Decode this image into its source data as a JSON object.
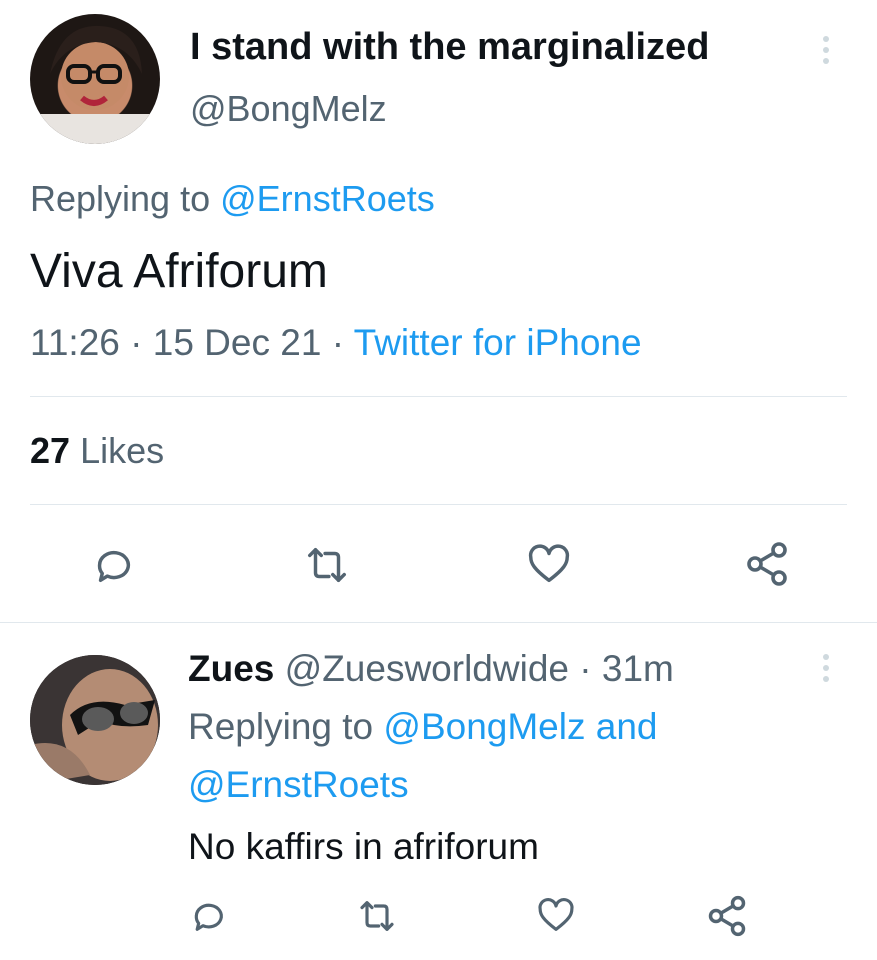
{
  "tweet": {
    "display_name": "I stand with the marginalized",
    "handle": "@BongMelz",
    "replying_prefix": "Replying to",
    "replying_to": "@ErnstRoets",
    "text": "Viva Afriforum",
    "time": "11:26",
    "sep1": "·",
    "date": "15 Dec 21",
    "sep2": "·",
    "source": "Twitter for iPhone",
    "likes_count": "27",
    "likes_label": "Likes"
  },
  "reply": {
    "display_name": "Zues",
    "handle": "@Zuesworldwide",
    "sep": "·",
    "time_ago": "31m",
    "replying_prefix": "Replying to",
    "replying_to_1": "@BongMelz",
    "and": "and",
    "replying_to_2": "@ErnstRoets",
    "text": "No kaffirs in afriforum"
  },
  "icons": [
    "reply-icon",
    "retweet-icon",
    "like-icon",
    "share-icon",
    "more-icon"
  ],
  "colors": {
    "link": "#1d9bf0",
    "muted": "#536471",
    "icon": "#536471",
    "divider": "#e1e8ed"
  }
}
